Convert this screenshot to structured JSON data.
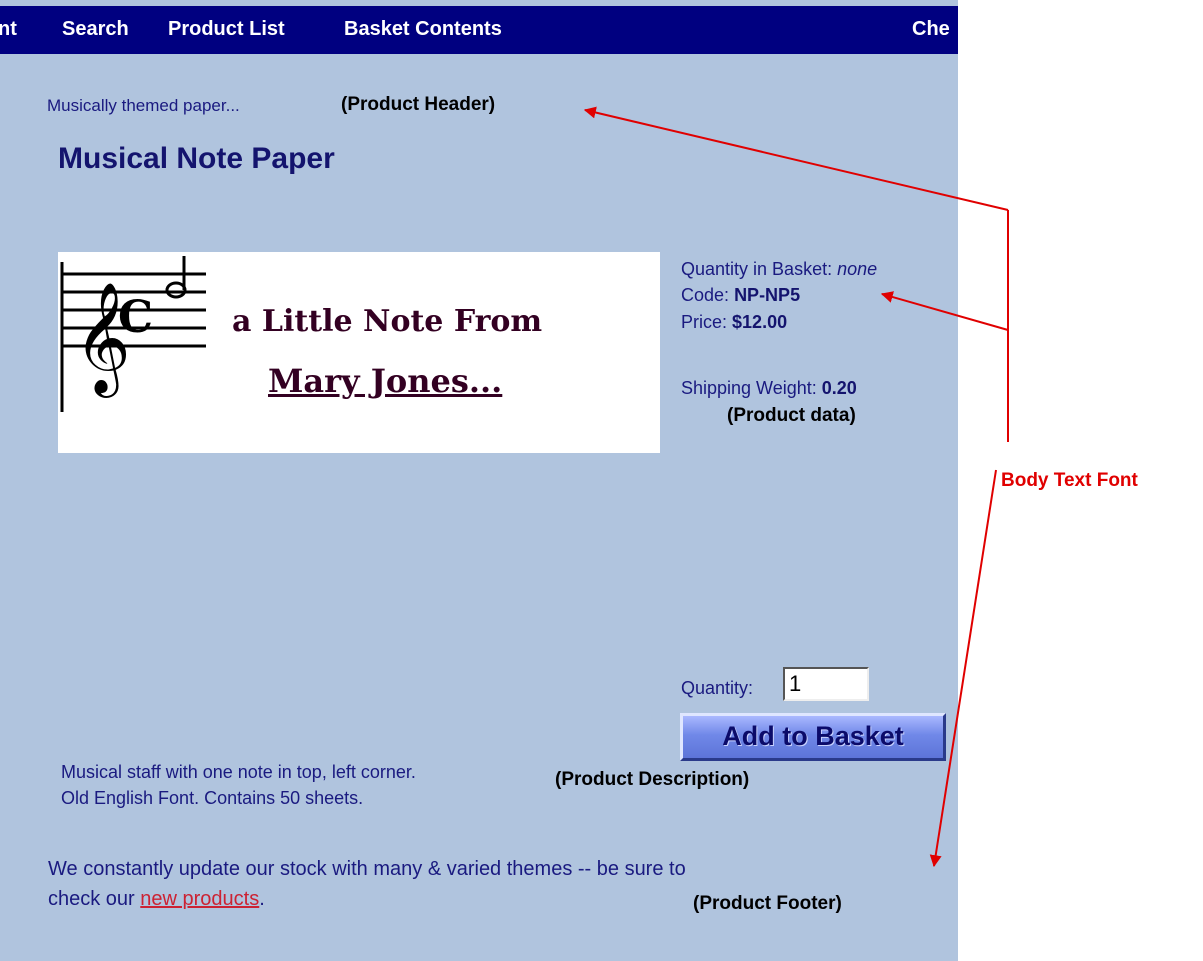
{
  "nav": {
    "items": [
      "nt",
      "Search",
      "Product List",
      "Basket Contents",
      "Che"
    ]
  },
  "product": {
    "header": "Musically themed paper...",
    "title": "Musical Note Paper",
    "image": {
      "line1": "a Little Note From",
      "line2": "Mary Jones..."
    },
    "quantity_in_basket_label": "Quantity in Basket:",
    "quantity_in_basket_value": "none",
    "code_label": "Code:",
    "code_value": "NP-NP5",
    "price_label": "Price:",
    "price_value": "$12.00",
    "weight_label": "Shipping Weight:",
    "weight_value": "0.20",
    "quantity_label": "Quantity:",
    "quantity_value": "1",
    "add_button": "Add to Basket",
    "description_line1": "Musical staff with one note in top, left corner.",
    "description_line2": "Old English Font. Contains 50 sheets.",
    "footer_text1": "We constantly update our stock with many & varied themes -- be sure to",
    "footer_text2_before": "check our",
    "footer_link": "new products",
    "footer_text2_after": "."
  },
  "annotations": {
    "product_header": "(Product Header)",
    "product_data": "(Product data)",
    "product_description": "(Product Description)",
    "product_footer": "(Product Footer)",
    "body_text_font": "Body Text Font"
  },
  "colors": {
    "background": "#b0c4de",
    "navbar": "#000080",
    "annotation_red": "#e00000"
  }
}
